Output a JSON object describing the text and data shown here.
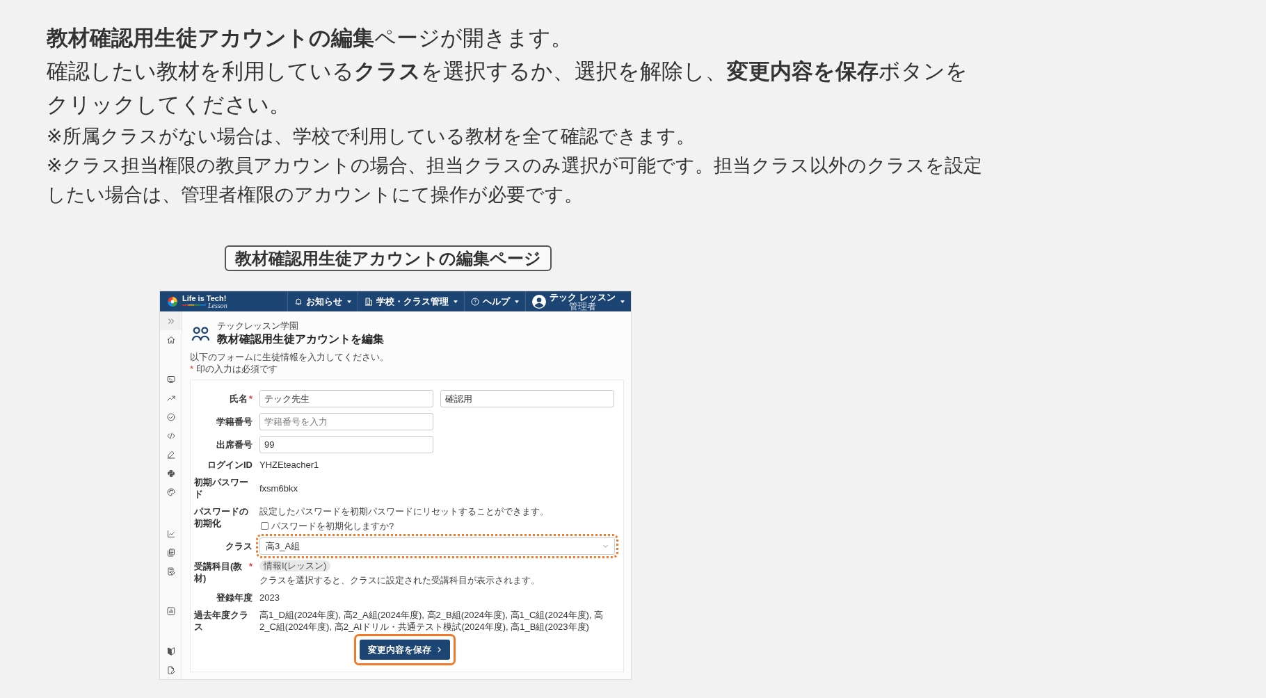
{
  "instructions": [
    {
      "kind": "main",
      "text": "**教材確認用生徒アカウントの編集**ページが開きます。"
    },
    {
      "kind": "main",
      "text": "確認したい教材を利用している**クラス**を選択するか、選択を解除し、**変更内容を保存**ボタンをクリックしてください。"
    },
    {
      "kind": "note",
      "text": "※所属クラスがない場合は、学校で利用している教材を全て確認できます。"
    },
    {
      "kind": "note",
      "text": "※クラス担当権限の教員アカウントの場合、担当クラスのみ選択が可能です。担当クラス以外のクラスを設定したい場合は、管理者権限のアカウントにて操作が必要です。"
    }
  ],
  "caption": "教材確認用生徒アカウントの編集ページ",
  "screenshot": {
    "header": {
      "brand": "Life is Tech!",
      "brand_sub": "Lesson",
      "menus": [
        {
          "label": "お知らせ"
        },
        {
          "label": "学校・クラス管理"
        },
        {
          "label": "ヘルプ"
        }
      ],
      "user": {
        "name": "テック レッスン",
        "role": "管理者"
      }
    },
    "page": {
      "school": "テックレッスン学園",
      "title": "教材確認用生徒アカウントを編集",
      "intro": "以下のフォームに生徒情報を入力してください。",
      "required_note": {
        "mark": "*",
        "text": "印の入力は必須です"
      }
    },
    "form": {
      "rows": [
        {
          "kind": "inputs",
          "label": "氏名",
          "required_mark": "*",
          "fields": [
            {
              "value": "テック先生"
            },
            {
              "value": "確認用"
            }
          ]
        },
        {
          "kind": "inputs",
          "label": "学籍番号",
          "fields": [
            {
              "placeholder": "学籍番号を入力"
            }
          ]
        },
        {
          "kind": "inputs",
          "label": "出席番号",
          "fields": [
            {
              "value": "99"
            }
          ]
        },
        {
          "kind": "text",
          "label": "ログインID",
          "value": "YHZEteacher1"
        },
        {
          "kind": "text",
          "label": "初期パスワード",
          "value": "fxsm6bkx"
        },
        {
          "kind": "reset",
          "label": "パスワードの初期化",
          "description": "設定したパスワードを初期パスワードにリセットすることができます。",
          "checkbox": {
            "label": "パスワードを初期化しますか?",
            "checked": false
          }
        },
        {
          "kind": "select",
          "label": "クラス",
          "value": "高3_A組",
          "highlighted": true
        },
        {
          "kind": "tags",
          "label": "受講科目(教材)",
          "required_mark": "*",
          "tags": [
            "情報I(レッスン)"
          ],
          "description": "クラスを選択すると、クラスに設定された受講科目が表示されます。"
        },
        {
          "kind": "text",
          "label": "登録年度",
          "value": "2023"
        },
        {
          "kind": "text",
          "label": "過去年度クラス",
          "value": "高1_D組(2024年度), 高2_A組(2024年度), 高2_B組(2024年度), 高1_C組(2024年度), 高2_C組(2024年度), 高2_AIドリル・共通テスト模試(2024年度), 高1_B組(2023年度)"
        }
      ]
    },
    "save_button": {
      "label": "変更内容を保存",
      "highlighted": true
    }
  }
}
